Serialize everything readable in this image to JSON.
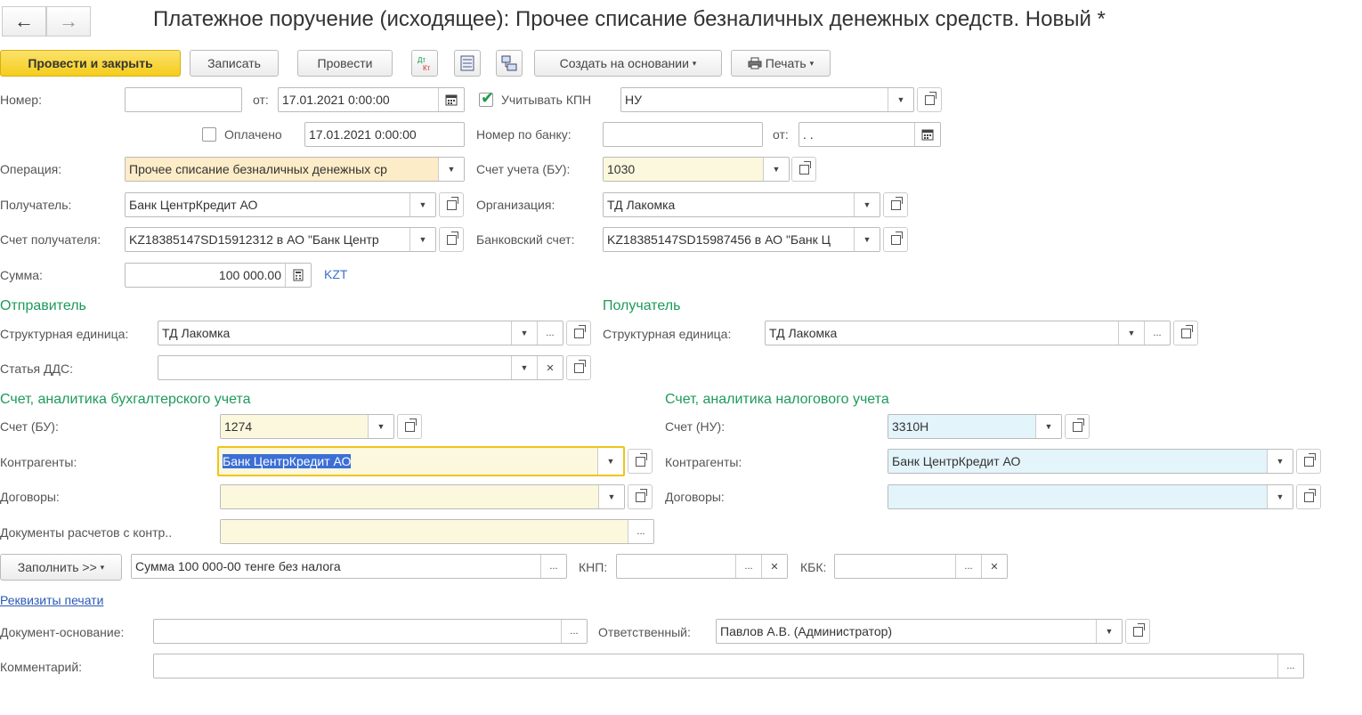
{
  "window": {
    "title": "Платежное поручение (исходящее): Прочее списание безналичных денежных средств. Новый *"
  },
  "toolbar": {
    "post_close": "Провести и закрыть",
    "save": "Записать",
    "post": "Провести",
    "create_based": "Создать на основании",
    "print": "Печать"
  },
  "header": {
    "number_label": "Номер:",
    "number": "",
    "from_label": "от:",
    "date": "17.01.2021  0:00:00",
    "kpn_label": "Учитывать КПН",
    "kpn_value": "НУ",
    "paid_label": "Оплачено",
    "paid_date": "17.01.2021  0:00:00",
    "bank_no_label": "Номер по банку:",
    "bank_no": "",
    "bank_from_label": "от:",
    "bank_date": " .  .",
    "operation_label": "Операция:",
    "operation": "Прочее списание безналичных денежных ср",
    "account_bu_label": "Счет учета (БУ):",
    "account_bu": "1030",
    "recipient_label": "Получатель:",
    "recipient": "Банк ЦентрКредит АО",
    "org_label": "Организация:",
    "org": "ТД Лакомка",
    "recipient_account_label": "Счет получателя:",
    "recipient_account": "KZ18385147SD15912312 в АО \"Банк Центр",
    "bank_account_label": "Банковский счет:",
    "bank_account": "KZ18385147SD15987456 в АО \"Банк Ц",
    "sum_label": "Сумма:",
    "sum": "100 000.00",
    "currency": "KZT"
  },
  "sender": {
    "title": "Отправитель",
    "unit_label": "Структурная единица:",
    "unit": "ТД Лакомка",
    "dds_label": "Статья ДДС:",
    "dds": ""
  },
  "receiver": {
    "title": "Получатель",
    "unit_label": "Структурная единица:",
    "unit": "ТД Лакомка"
  },
  "bu": {
    "title": "Счет, аналитика бухгалтерского учета",
    "account_label": "Счет (БУ):",
    "account": "1274",
    "contractors_label": "Контрагенты:",
    "contractors": "Банк ЦентрКредит АО",
    "contracts_label": "Договоры:",
    "contracts": "",
    "docs_label": "Документы расчетов с контр..",
    "docs": ""
  },
  "nu": {
    "title": "Счет, аналитика налогового учета",
    "account_label": "Счет (НУ):",
    "account": "3310Н",
    "contractors_label": "Контрагенты:",
    "contractors": "Банк ЦентрКредит АО",
    "contracts_label": "Договоры:",
    "contracts": ""
  },
  "fill": {
    "button": "Заполнить >>",
    "purpose": "Сумма 100 000-00  тенге  без налога",
    "knp_label": "КНП:",
    "knp": "",
    "kbk_label": "КБК:",
    "kbk": ""
  },
  "footer": {
    "print_link": "Реквизиты печати",
    "basis_label": "Документ-основание:",
    "basis": "",
    "responsible_label": "Ответственный:",
    "responsible": "Павлов А.В. (Администратор)",
    "comment_label": "Комментарий:",
    "comment": ""
  },
  "icons": {
    "back": "←",
    "forward": "→",
    "dropdown": "▾",
    "ellipsis": "...",
    "clear": "✕",
    "calendar": "calendar-icon",
    "calculator": "calculator-icon",
    "printer": "printer-icon"
  }
}
